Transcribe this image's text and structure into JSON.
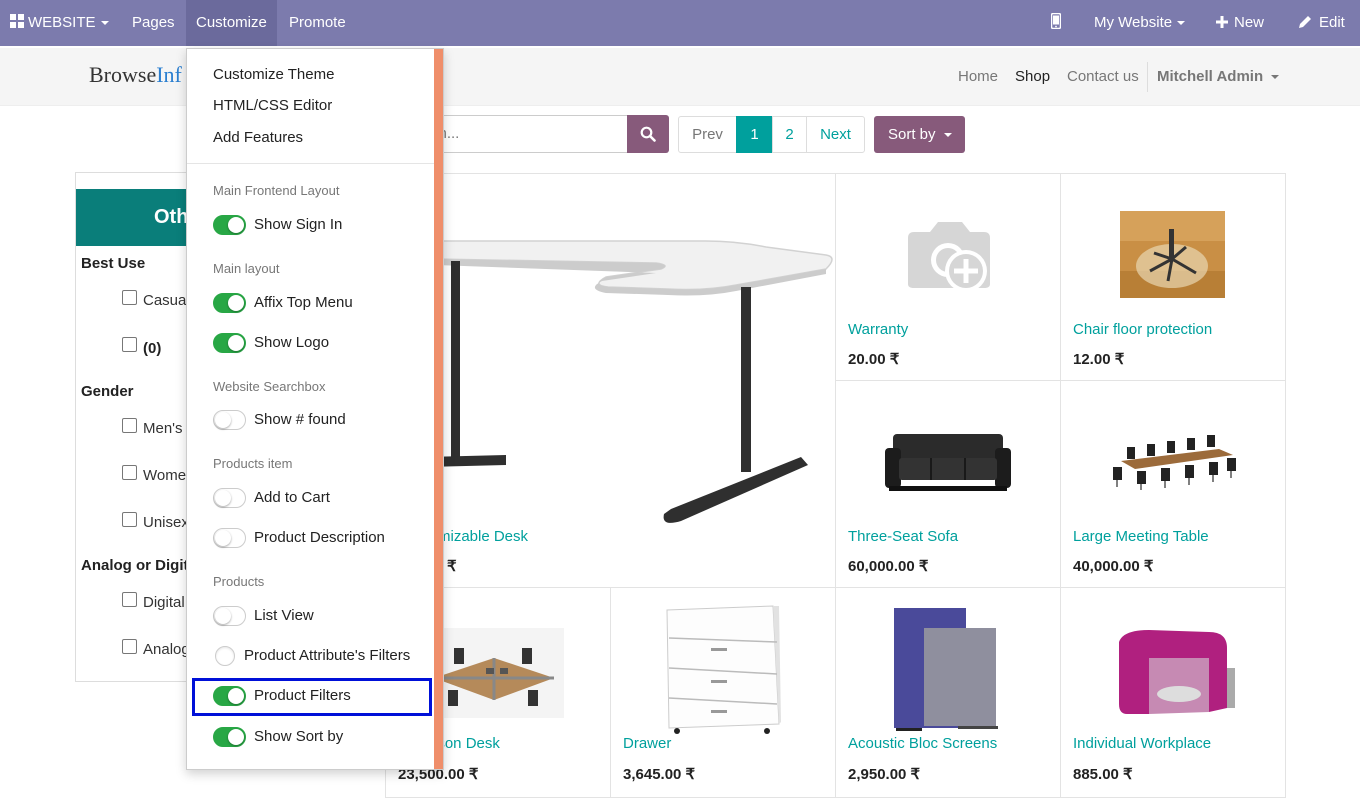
{
  "topbar": {
    "website_label": "WEBSITE",
    "pages_label": "Pages",
    "customize_label": "Customize",
    "promote_label": "Promote",
    "site_label": "My Website",
    "new_label": "New",
    "edit_label": "Edit",
    "colors": {
      "bar": "#7c7bad",
      "active": "#6b6a9c"
    }
  },
  "header": {
    "logo_part1": "Browse",
    "logo_part2": "Inf",
    "nav": [
      "Home",
      "Shop",
      "Contact us"
    ],
    "active_nav": "Shop",
    "user": "Mitchell Admin"
  },
  "search": {
    "placeholder": "ch..."
  },
  "pager": {
    "prev": "Prev",
    "pages": [
      "1",
      "2"
    ],
    "current_page": "1",
    "next": "Next"
  },
  "sort_label": "Sort by",
  "sidebar": {
    "title": "Oth",
    "groups": [
      {
        "label": "Best Use",
        "options": [
          "Casua",
          "(0)"
        ]
      },
      {
        "label": "Gender",
        "options": [
          "Men's",
          "Wome",
          "Unisex"
        ]
      },
      {
        "label": "Analog or Digit",
        "options": [
          "Digital",
          "Analog"
        ]
      }
    ]
  },
  "customize_menu": {
    "top_items": [
      "Customize Theme",
      "HTML/CSS Editor",
      "Add Features"
    ],
    "sections": [
      {
        "header": "Main Frontend Layout",
        "toggles": [
          {
            "label": "Show Sign In",
            "on": true
          }
        ]
      },
      {
        "header": "Main layout",
        "toggles": [
          {
            "label": "Affix Top Menu",
            "on": true
          },
          {
            "label": "Show Logo",
            "on": true
          }
        ]
      },
      {
        "header": "Website Searchbox",
        "toggles": [
          {
            "label": "Show # found",
            "on": false
          }
        ]
      },
      {
        "header": "Products item",
        "toggles": [
          {
            "label": "Add to Cart",
            "on": false
          },
          {
            "label": "Product Description",
            "on": false
          }
        ]
      },
      {
        "header": "Products",
        "toggles": [
          {
            "label": "List View",
            "on": false
          },
          {
            "label": "Product Attribute's Filters",
            "on": false,
            "kind": "radio"
          },
          {
            "label": "Product Filters",
            "on": true,
            "highlighted": true
          },
          {
            "label": "Show Sort by",
            "on": true
          }
        ]
      }
    ],
    "accent_color": "#ef8e6a",
    "highlight_color": "#0010d8"
  },
  "products": [
    {
      "name": "mizable Desk",
      "price": "₹"
    },
    {
      "name": "Warranty",
      "price": "20.00 ₹"
    },
    {
      "name": "Chair floor protection",
      "price": "12.00 ₹"
    },
    {
      "name": "Three-Seat Sofa",
      "price": "60,000.00 ₹"
    },
    {
      "name": "Large Meeting Table",
      "price": "40,000.00 ₹"
    },
    {
      "name": "erson Desk",
      "price": "23,500.00 ₹"
    },
    {
      "name": "Drawer",
      "price": "3,645.00 ₹"
    },
    {
      "name": "Acoustic Bloc Screens",
      "price": "2,950.00 ₹"
    },
    {
      "name": "Individual Workplace",
      "price": "885.00 ₹"
    }
  ],
  "colors": {
    "link": "#00a09d",
    "primary": "#875a7b",
    "toggle_on": "#28a745"
  }
}
